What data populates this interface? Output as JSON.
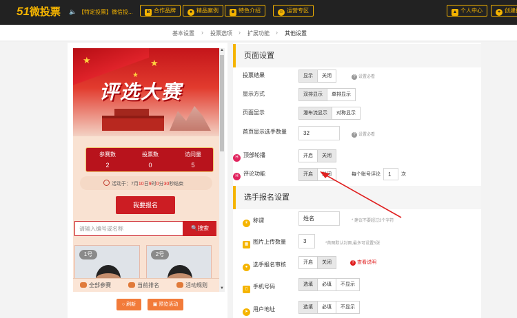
{
  "topbar": {
    "logo_num": "51",
    "logo_text": "微投票",
    "notice": "【特定投票】微信投...",
    "buttons": [
      "合作品牌",
      "精品案例",
      "特色介绍",
      "运营专区"
    ],
    "user_center": "个人中心",
    "create": "创建投"
  },
  "breadcrumb": [
    "基本设置",
    "投票选项",
    "扩展功能",
    "其他设置"
  ],
  "preview": {
    "banner_title": "评选大赛",
    "stats": [
      {
        "label": "参赛数",
        "value": "2"
      },
      {
        "label": "投票数",
        "value": "0"
      },
      {
        "label": "访问量",
        "value": "5"
      }
    ],
    "time_prefix": "活动于：7月",
    "time_day": "10",
    "time_mid": "日",
    "time_hour": "9",
    "time_h": "时",
    "time_min": "0",
    "time_m": "分",
    "time_sec": "30",
    "time_suffix": "秒结束",
    "signup_button": "我要报名",
    "search_placeholder": "请输入编号或名称",
    "search_button": "🔍搜索",
    "cards": [
      "1号",
      "2号"
    ],
    "nav": [
      "全部参赛",
      "当前排名",
      "活动规则"
    ],
    "refresh_button": "刷新",
    "preview_button": "预览活动"
  },
  "page_settings": {
    "title": "页面设置",
    "rows": [
      {
        "label": "投票结果",
        "options": [
          "显示",
          "关闭"
        ],
        "selected": 0,
        "hint": "设置必看"
      },
      {
        "label": "显示方式",
        "options": [
          "双排显示",
          "单排显示"
        ],
        "selected": 0
      },
      {
        "label": "页面显示",
        "options": [
          "瀑布流显示",
          "对称显示"
        ],
        "selected": 0
      },
      {
        "label": "首页显示选手数量",
        "value": "32",
        "hint": "设置必看"
      },
      {
        "label": "顶部轮播",
        "options": [
          "开启",
          "关闭"
        ],
        "selected": 1
      },
      {
        "label": "评论功能",
        "options": [
          "开启",
          "关闭"
        ],
        "selected": 0
      }
    ],
    "comment_limit_prefix": "每个账号评论",
    "comment_limit_value": "1",
    "comment_limit_suffix": "次"
  },
  "signup_settings": {
    "title": "选手报名设置",
    "name_label": "称谓",
    "name_value": "姓名",
    "name_hint": "* 建议不要超过3个字符",
    "image_label": "图片上传数量",
    "image_value": "3",
    "image_hint": "*首图默认封面,最多可设置5张",
    "audit_label": "选手报名审核",
    "audit_options": [
      "开启",
      "关闭"
    ],
    "audit_selected": 1,
    "audit_link": "查看说明",
    "phone_label": "手机号码",
    "phone_options": [
      "选填",
      "必填",
      "不显示"
    ],
    "address_label": "用户地址",
    "address_options": [
      "选填",
      "必填",
      "不显示"
    ]
  },
  "colors": {
    "accent": "#f5b400",
    "brand_red": "#cc1d23",
    "hot_tag": "#e0245e"
  }
}
